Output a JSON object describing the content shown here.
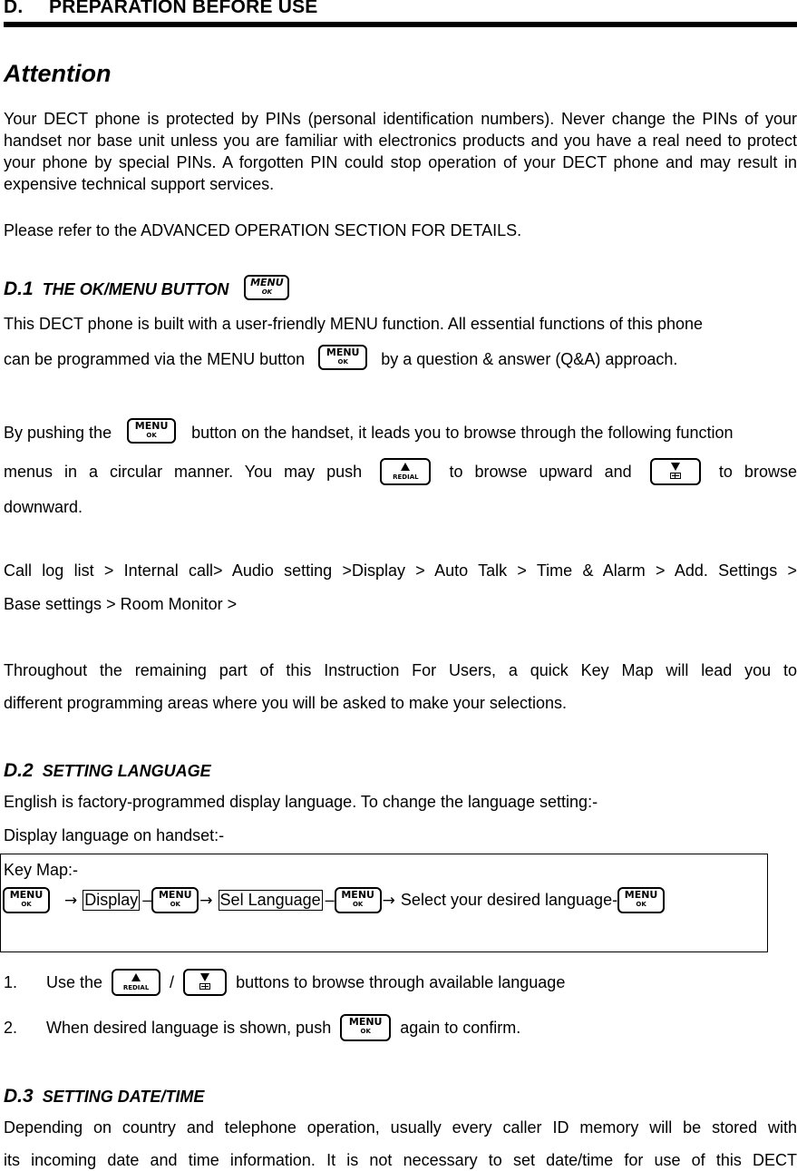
{
  "header": {
    "section_letter": "D.",
    "section_title": "PREPARATION BEFORE USE"
  },
  "attention": {
    "title": "Attention",
    "paragraph": "Your DECT phone is protected by PINs (personal identification numbers). Never change the PINs of your handset nor base unit unless you are familiar with electronics products and you have a real need to protect your phone by special PINs. A forgotten PIN could stop operation of your DECT phone and may result in expensive technical support services.",
    "refer": "Please refer to the ADVANCED OPERATION SECTION FOR DETAILS."
  },
  "keys": {
    "menu_top": "MENU",
    "menu_bottom": "OK",
    "redial_label": "REDIAL"
  },
  "d1": {
    "number": "D.1",
    "title": "THE OK/MENU BUTTON",
    "p1_line1": "This DECT phone is built with a user-friendly MENU function. All essential functions of this phone",
    "p1_line2_a": "can be programmed via the MENU button",
    "p1_line2_b": "by a question & answer (Q&A) approach.",
    "p2_line1_a": "By pushing the",
    "p2_line1_b": "button on the handset, it leads you to browse through the following function",
    "p2_line2_a": "menus in a circular manner. You may push",
    "p2_line2_b": "to browse upward and",
    "p2_line2_c": "to browse",
    "p2_line3": "downward.",
    "menu_list_line1": "Call log list > Internal call> Audio setting >Display > Auto Talk > Time & Alarm > Add. Settings >",
    "menu_list_line2": "Base settings > Room Monitor >",
    "p3_line1": "Throughout the remaining part of this Instruction For Users, a quick Key Map will lead you to",
    "p3_line2": "different programming areas where you will be asked to make your selections."
  },
  "d2": {
    "number": "D.2",
    "title": "SETTING LANGUAGE",
    "line1": "English is factory-programmed display language. To change the language setting:-",
    "line2": "Display language on handset:-",
    "keymap": {
      "label": "Key Map:-",
      "arrow": "→",
      "dash": "–",
      "step1": "Display",
      "step2": "Sel Language",
      "step3": "Select your desired language-"
    },
    "steps": [
      {
        "num": "1.",
        "text_a": "Use the",
        "sep": "/",
        "text_b": "buttons to browse through available language"
      },
      {
        "num": "2.",
        "text_a": "When desired language is shown, push",
        "text_b": "again to confirm."
      }
    ]
  },
  "d3": {
    "number": "D.3",
    "title": "SETTING DATE/TIME",
    "line1": "Depending on country and telephone operation, usually every caller ID memory will be stored with",
    "line2": "its incoming date and time information. It is not necessary to set date/time for use of this DECT"
  }
}
